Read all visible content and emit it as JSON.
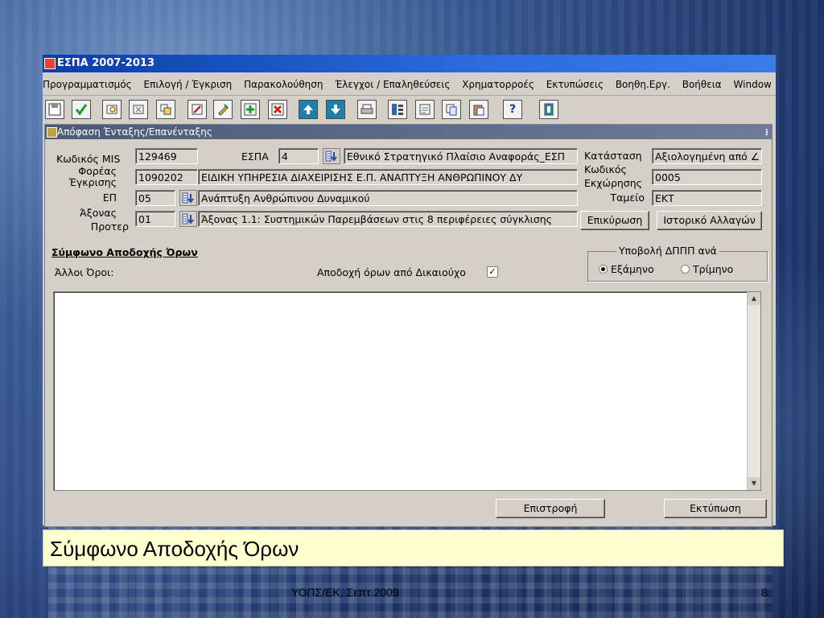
{
  "app": {
    "title": "ΕΣΠΑ 2007-2013"
  },
  "menu": [
    "Προγραμματισμός",
    "Επιλογή / Έγκριση",
    "Παρακολούθηση",
    "Έλεγχοι / Επαληθεύσεις",
    "Χρηματορροές",
    "Εκτυπώσεις",
    "Βοηθη.Εργ.",
    "Βοήθεια",
    "Window"
  ],
  "toolbar": [
    "save-icon",
    "accept-icon",
    "query-icon",
    "clear-query-icon",
    "copy-record-icon",
    "edit-icon",
    "pencil-icon",
    "insert-record-icon",
    "delete-record-icon",
    "arrow-up-icon",
    "arrow-down-icon",
    "print-icon",
    "list-icon",
    "document-icon",
    "copy-icon",
    "paste-icon",
    "help-icon",
    "exit-icon"
  ],
  "form": {
    "title": "Απόφαση Ένταξης/Επανένταξης",
    "minimize": "⭳",
    "labels": {
      "mis": "Κωδικός MIS",
      "espa": "ΕΣΠΑ",
      "foreas": "Φορέας",
      "egkrisis": "Έγκρισης",
      "ep": "ΕΠ",
      "axonas": "Άξονας",
      "proter": "Προτερ",
      "katastasi": "Κατάσταση",
      "kodikos": "Κωδικός",
      "ekxorisis": "Εκχώρησης",
      "tameio": "Ταμείο"
    },
    "values": {
      "mis": "129469",
      "espa_code": "4",
      "espa_desc": "Εθνικό Στρατηγικό Πλαίσιο Αναφοράς_ΕΣΠ",
      "foreas_code": "1090202",
      "foreas_desc": "ΕΙΔΙΚΗ ΥΠΗΡΕΣΙΑ ΔΙΑΧΕΙΡΙΣΗΣ Ε.Π. ΑΝΑΠΤΥΞΗ ΑΝΘΡΩΠΙΝΟΥ ΔΥ",
      "ep_code": "05",
      "ep_desc": "Ανάπτυξη Ανθρώπινου Δυναμικού",
      "axonas_code": "01",
      "axonas_desc": "Άξονας 1.1: Συστημικών Παρεμβάσεων στις 8 περιφέρειες σύγκλισης",
      "katastasi": "Αξιολογημένη από ∠",
      "kodikos_ekxorisis": "0005",
      "tameio": "ΕΚΤ"
    },
    "buttons": {
      "epikyrosi": "Επικύρωση",
      "istoriko": "Ιστορικό Αλλαγών",
      "epistrofi": "Επιστροφή",
      "ektyposi": "Εκτύπωση"
    },
    "section_title": "Σύμφωνο Αποδοχής Όρων",
    "alloi_oroi": "Άλλοι Όροι:",
    "apodoxi_label": "Αποδοχή όρων από Δικαιούχο",
    "apodoxi_checked": true,
    "ypovoli_title": "Υποβολή ΔΠΠΠ ανά",
    "radio_1": "Εξάμηνο",
    "radio_2": "Τρίμηνο",
    "radio_selected": "Εξάμηνο"
  },
  "caption": "Σύμφωνο Αποδοχής Όρων",
  "footer": "ΥΟΠΣ/ΕΚ, Σεπτ.2009",
  "page_number": "8"
}
